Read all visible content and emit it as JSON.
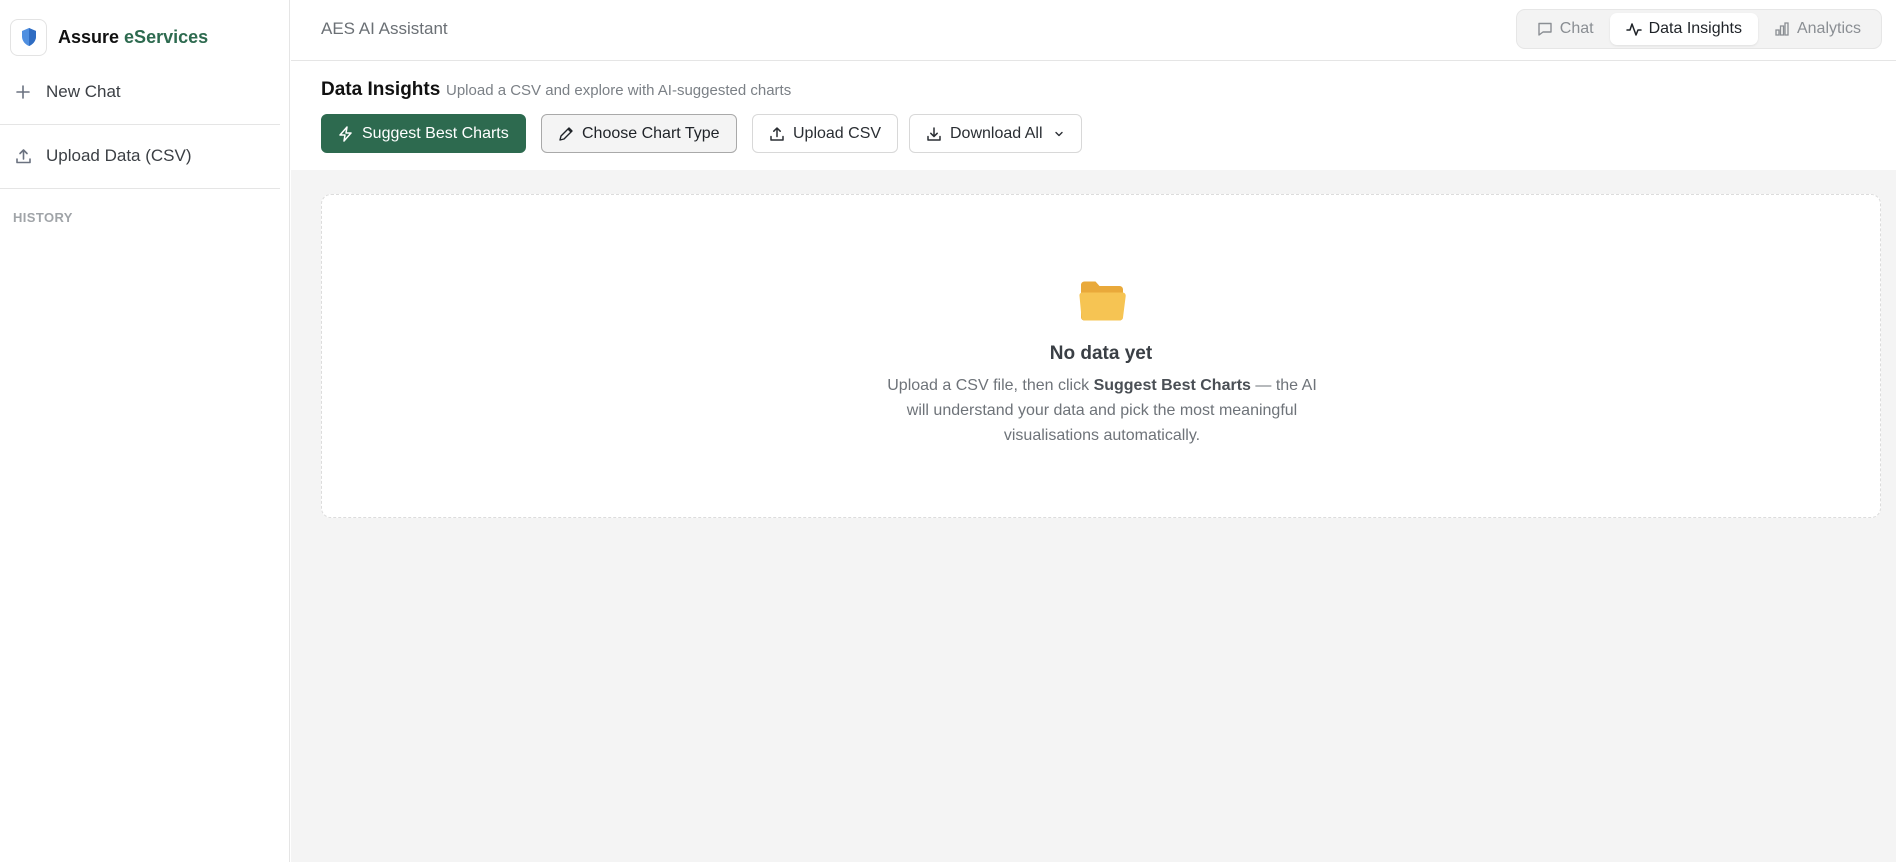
{
  "brand": {
    "name_main": "Assure",
    "name_accent": "eServices",
    "logo_icon": "shield-icon"
  },
  "sidebar": {
    "new_chat": {
      "label": "New Chat",
      "icon": "plus-icon"
    },
    "upload": {
      "label": "Upload Data (CSV)",
      "icon": "upload-icon"
    },
    "history_label": "HISTORY"
  },
  "topbar": {
    "title": "AES AI Assistant",
    "tabs": [
      {
        "label": "Chat",
        "icon": "chat-bubble-icon",
        "active": false
      },
      {
        "label": "Data Insights",
        "icon": "activity-icon",
        "active": true
      },
      {
        "label": "Analytics",
        "icon": "bar-chart-icon",
        "active": false
      }
    ]
  },
  "header": {
    "title": "Data Insights",
    "subtitle": "Upload a CSV and explore with AI-suggested charts",
    "buttons": {
      "suggest": "Suggest Best Charts",
      "choose": "Choose Chart Type",
      "upload": "Upload CSV",
      "download": "Download All"
    }
  },
  "empty_state": {
    "icon": "folder-icon",
    "title": "No data yet",
    "text_before": "Upload a CSV file, then click",
    "text_bold": "Suggest Best Charts",
    "text_after": "— the AI will understand your data and pick the most meaningful visualisations automatically."
  },
  "colors": {
    "accent": "#2d6a4f",
    "folder": "#f6c453"
  }
}
